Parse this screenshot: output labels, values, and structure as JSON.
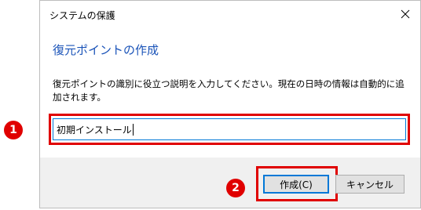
{
  "window": {
    "title": "システムの保護"
  },
  "dialog": {
    "heading": "復元ポイントの作成",
    "description": "復元ポイントの識別に役立つ説明を入力してください。現在の日時の情報は自動的に追加されます。",
    "restore_point_name_value": "初期インストール"
  },
  "buttons": {
    "create_label": "作成(C)",
    "cancel_label": "キャンセル"
  },
  "annotations": {
    "marker_1": "1",
    "marker_2": "2"
  },
  "colors": {
    "heading_text": "#1a53b8",
    "highlight_red": "#e00000",
    "focus_blue": "#0078d7"
  },
  "icons": {
    "close": "close-icon"
  }
}
